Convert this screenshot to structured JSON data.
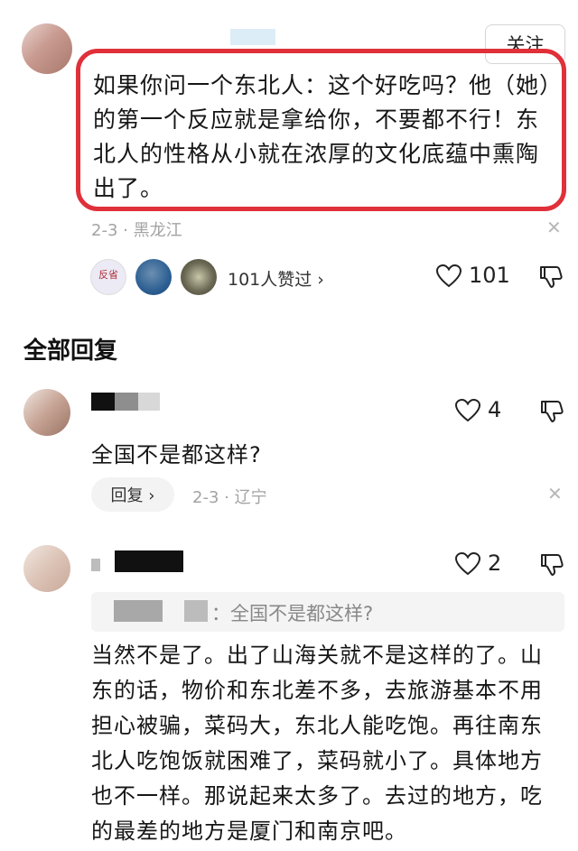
{
  "top_comment": {
    "follow_label": "关注",
    "text": "如果你问一个东北人：这个好吃吗？他（她）的第一个反应就是拿给你，不要都不行！东北人的性格从小就在浓厚的文化底蕴中熏陶出了。",
    "date_location": "2-3 · 黑龙江",
    "likers_summary": "101人赞过 ›",
    "like_count": "101",
    "liker_badge_text": "反省"
  },
  "section_title": "全部回复",
  "replies": [
    {
      "text": "全国不是都这样?",
      "like_count": "4",
      "reply_label": "回复 ›",
      "date_location": "2-3 · 辽宁"
    },
    {
      "like_count": "2",
      "quote_text": "：全国不是都这样?",
      "text": "当然不是了。出了山海关就不是这样的了。山东的话，物价和东北差不多，去旅游基本不用担心被骗，菜码大，东北人能吃饱。再往南东北人吃饱饭就困难了，菜码就小了。具体地方也不一样。那说起来太多了。去过的地方，吃的最差的地方是厦门和南京吧。"
    }
  ],
  "colors": {
    "highlight_border": "#e0303a",
    "meta_text": "#a3a3a3"
  },
  "icons": [
    "heart-icon",
    "dislike-icon",
    "close-icon",
    "chevron-right-icon"
  ]
}
